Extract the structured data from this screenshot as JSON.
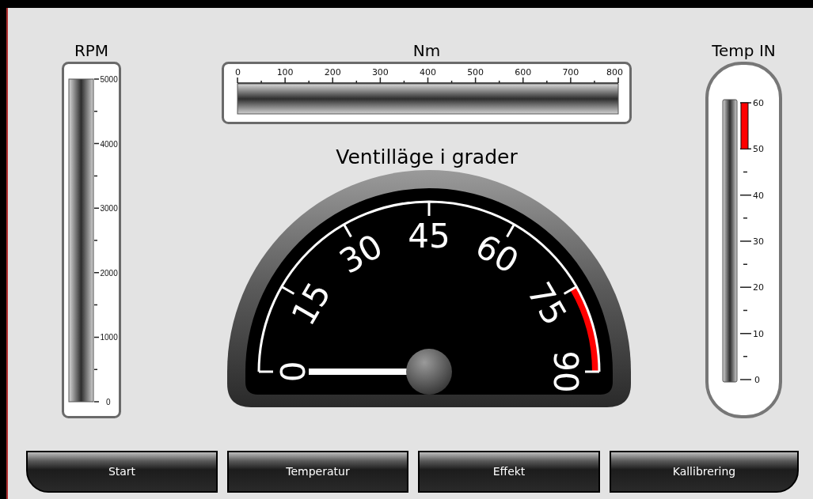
{
  "rpm": {
    "title": "RPM",
    "scale": [
      "5000",
      "4000",
      "3000",
      "2000",
      "1000",
      "0"
    ]
  },
  "torque": {
    "title": "Nm",
    "scale": [
      "0",
      "100",
      "200",
      "300",
      "400",
      "500",
      "600",
      "700",
      "800"
    ]
  },
  "dial": {
    "title": "Ventilläge i grader",
    "scale": [
      "0",
      "15",
      "30",
      "45",
      "60",
      "75",
      "90"
    ]
  },
  "temp": {
    "title": "Temp IN",
    "scale": [
      "60",
      "50",
      "40",
      "30",
      "20",
      "10",
      "0"
    ]
  },
  "buttons": [
    {
      "label": "Start"
    },
    {
      "label": "Temperatur"
    },
    {
      "label": "Effekt"
    },
    {
      "label": "Kallibrering"
    }
  ]
}
